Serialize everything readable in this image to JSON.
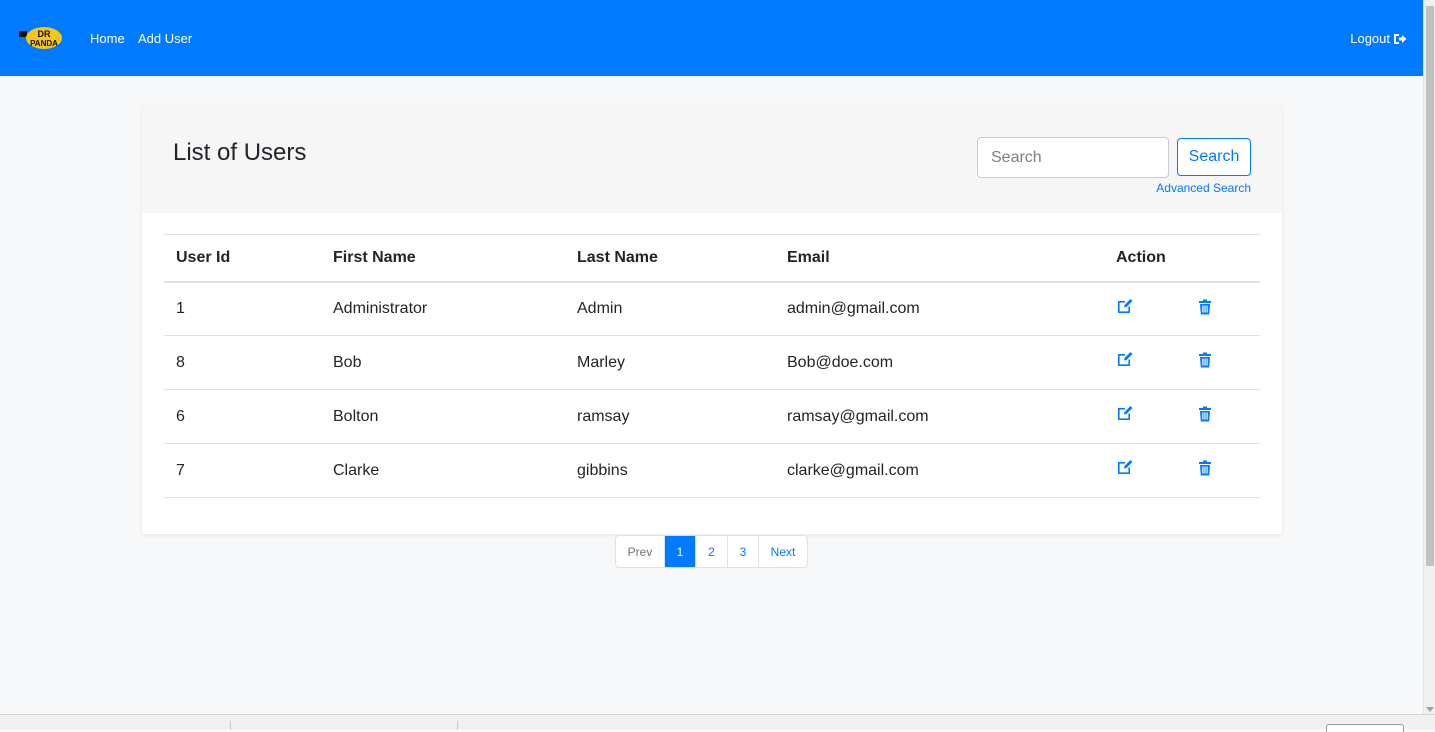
{
  "nav": {
    "brand_line1": "DR",
    "brand_line2": "PANDA",
    "links": [
      "Home",
      "Add User"
    ],
    "logout": "Logout",
    "color": "#007bff"
  },
  "header": {
    "title": "List of Users",
    "search_placeholder": "Search",
    "search_button": "Search",
    "advanced_search": "Advanced Search"
  },
  "table": {
    "columns": [
      "User Id",
      "First Name",
      "Last Name",
      "Email",
      "Action"
    ],
    "rows": [
      {
        "id": "1",
        "first": "Administrator",
        "last": "Admin",
        "email": "admin@gmail.com"
      },
      {
        "id": "8",
        "first": "Bob",
        "last": "Marley",
        "email": "Bob@doe.com"
      },
      {
        "id": "6",
        "first": "Bolton",
        "last": "ramsay",
        "email": "ramsay@gmail.com"
      },
      {
        "id": "7",
        "first": "Clarke",
        "last": "gibbins",
        "email": "clarke@gmail.com"
      }
    ],
    "action_icons": [
      "edit-icon",
      "trash-icon"
    ]
  },
  "pagination": {
    "prev": "Prev",
    "pages": [
      "1",
      "2",
      "3"
    ],
    "active_page": "1",
    "next": "Next"
  }
}
